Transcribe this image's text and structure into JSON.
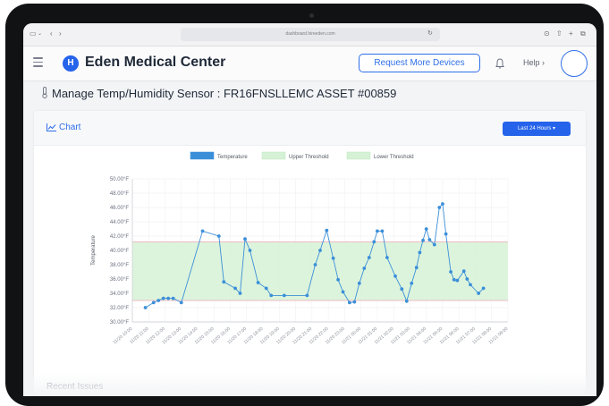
{
  "browser": {
    "url": "dashboard.hireeden.com",
    "icons": [
      "sidebar-icon",
      "back-icon",
      "forward-icon",
      "shield-icon",
      "reload-icon",
      "download-icon",
      "share-icon",
      "new-tab-icon",
      "tabs-icon"
    ]
  },
  "header": {
    "logo_letter": "H",
    "brand": "Eden Medical Center",
    "request_button": "Request More Devices",
    "help_label": "Help ›"
  },
  "page": {
    "title": "Manage Temp/Humidity Sensor : FR16FNSLLEMC ASSET #00859"
  },
  "card": {
    "chart_link": "Chart",
    "range_button": "Last 24 Hours ▾"
  },
  "recent": {
    "label": "Recent Issues"
  },
  "colors": {
    "accent": "#2563eb",
    "temperature": "#3b8fd9",
    "threshold_fill": "#d6f2d6",
    "threshold_line": "#f2a8b8"
  },
  "chart_data": {
    "type": "line",
    "legend": [
      "Temperature",
      "Upper Threshold",
      "Lower Threshold"
    ],
    "ylabel": "Temperature",
    "ylim": [
      30,
      50
    ],
    "yticks": [
      "50.00°F",
      "48.00°F",
      "46.00°F",
      "44.00°F",
      "42.00°F",
      "40.00°F",
      "38.00°F",
      "36.00°F",
      "34.00°F",
      "32.00°F",
      "30.00°F"
    ],
    "xticks": [
      "11/20 10:00",
      "11/20 11:00",
      "11/20 12:00",
      "11/20 13:00",
      "11/20 14:00",
      "11/20 15:00",
      "11/20 16:00",
      "11/20 17:00",
      "11/20 18:00",
      "11/20 19:00",
      "11/20 20:00",
      "11/20 21:00",
      "11/20 22:00",
      "11/20 23:00",
      "11/21 00:00",
      "11/21 01:00",
      "11/21 02:00",
      "11/21 03:00",
      "11/21 04:00",
      "11/21 05:00",
      "11/21 06:00",
      "11/21 07:00",
      "11/21 08:00",
      "11/21 09:00"
    ],
    "threshold_band": [
      33,
      41.2
    ],
    "grid": true,
    "series": [
      {
        "name": "Temperature",
        "x": [
          0.8,
          1.3,
          1.6,
          1.9,
          2.2,
          2.5,
          3.0,
          4.3,
          5.3,
          5.6,
          6.3,
          6.6,
          6.9,
          7.2,
          7.7,
          8.2,
          8.5,
          9.3,
          10.7,
          11.2,
          11.5,
          11.9,
          12.3,
          12.6,
          12.9,
          13.3,
          13.6,
          13.9,
          14.2,
          14.5,
          14.8,
          15.0,
          15.3,
          15.6,
          16.1,
          16.5,
          16.8,
          17.1,
          17.4,
          17.6,
          17.8,
          18.0,
          18.2,
          18.5,
          18.8,
          19.0,
          19.2,
          19.5,
          19.7,
          19.9,
          20.3,
          20.5,
          20.7,
          21.2,
          21.5
        ],
        "values": [
          32.0,
          32.7,
          33.0,
          33.3,
          33.3,
          33.3,
          32.7,
          42.7,
          42.0,
          35.6,
          34.7,
          34.0,
          41.6,
          40.0,
          35.5,
          34.7,
          33.7,
          33.7,
          33.7,
          38.0,
          40.0,
          42.8,
          38.9,
          35.9,
          34.2,
          32.7,
          32.8,
          35.4,
          37.5,
          39.0,
          41.2,
          42.7,
          42.7,
          39.0,
          36.4,
          34.6,
          32.9,
          35.4,
          37.6,
          39.7,
          41.4,
          43.0,
          41.5,
          40.8,
          46.0,
          46.5,
          42.3,
          37.0,
          35.9,
          35.8,
          37.1,
          36.0,
          35.2,
          34.0,
          34.7
        ]
      }
    ]
  }
}
